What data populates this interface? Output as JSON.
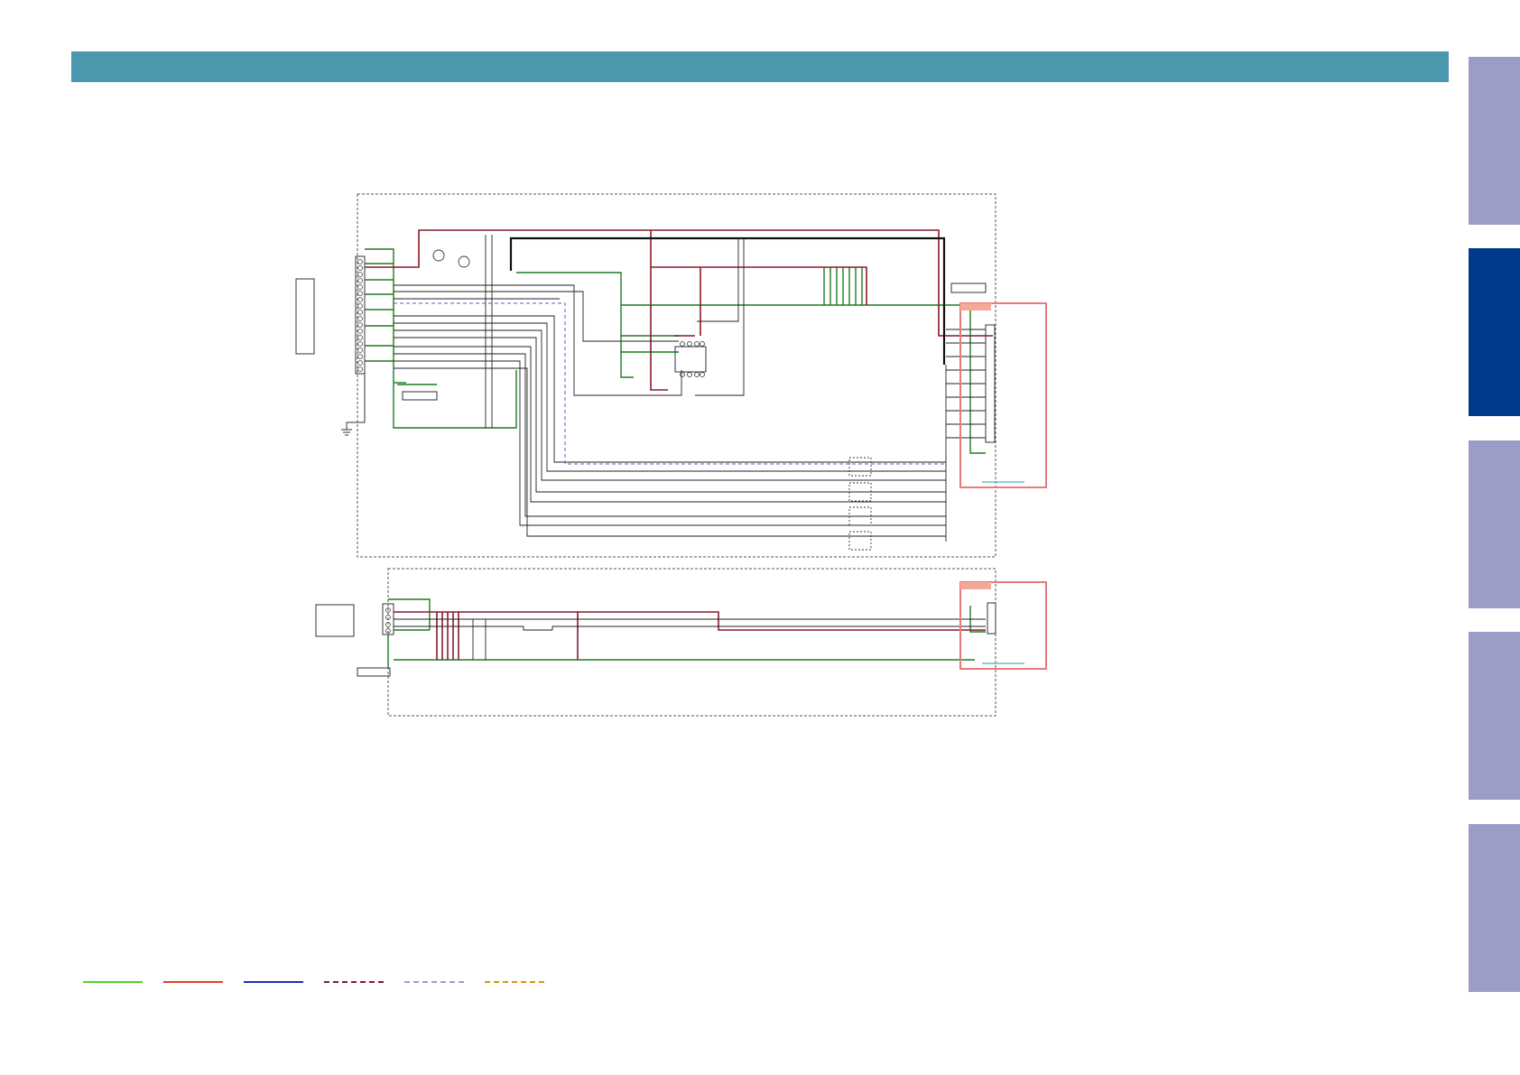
{
  "header": {
    "color": "#4a98ad"
  },
  "side_tabs": {
    "active_index": 1,
    "color": "#9c9cc8",
    "active_color": "#003a8c"
  },
  "legend": [
    {
      "color": "#55d12b",
      "style": "solid"
    },
    {
      "color": "#d8432a",
      "style": "solid"
    },
    {
      "color": "#1f2fb0",
      "style": "solid"
    },
    {
      "color": "#8a1a2a",
      "style": "dashed"
    },
    {
      "color": "#9a9ae0",
      "style": "dashed"
    },
    {
      "color": "#e0901a",
      "style": "dashed"
    }
  ],
  "diagram": {
    "type": "circuit-schematic",
    "blocks": 2,
    "highlight_color": "#e87a7a",
    "net_colors": {
      "ground": "#1f7a1f",
      "power": "#8a1a2a",
      "signal": "#222222",
      "clock": "#5060c0"
    }
  }
}
